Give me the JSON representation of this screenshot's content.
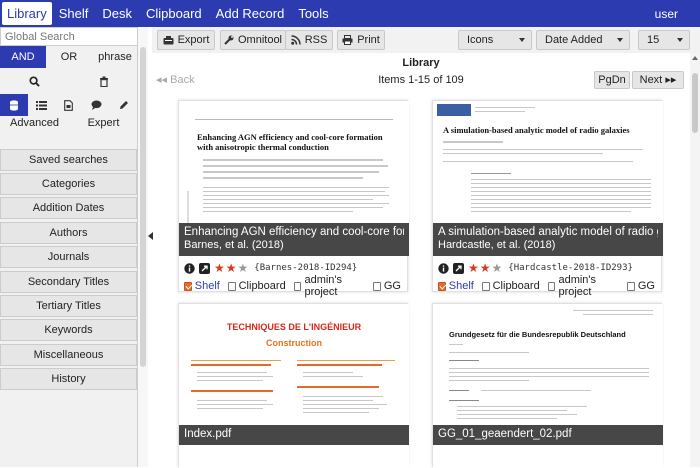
{
  "nav": {
    "items": [
      "Library",
      "Shelf",
      "Desk",
      "Clipboard",
      "Add Record",
      "Tools"
    ],
    "user": "user"
  },
  "sidebar": {
    "search_placeholder": "Global Search",
    "logic": [
      "AND",
      "OR",
      "phrase"
    ],
    "modes": [
      "Advanced",
      "Expert"
    ],
    "buttons": [
      "Saved searches",
      "Categories",
      "Addition Dates",
      "Authors",
      "Journals",
      "Secondary Titles",
      "Tertiary Titles",
      "Keywords",
      "Miscellaneous",
      "History"
    ]
  },
  "toolbar": {
    "export": "Export",
    "omnitool": "Omnitool",
    "rss": "RSS",
    "print": "Print",
    "view_select": "Icons",
    "sort_select": "Date Added",
    "per_page_select": "15"
  },
  "main": {
    "title": "Library",
    "back": "Back",
    "items_count": "Items 1-15 of 109",
    "pgdn": "PgDn",
    "next": "Next"
  },
  "cards": [
    {
      "title": "Enhancing AGN efficiency and cool-core formation",
      "authors": "Barnes, et al. (2018)",
      "key": "{Barnes-2018-ID294}",
      "stars": 3,
      "doc_title": "Enhancing AGN efficiency and cool-core formation with anisotropic thermal conduction",
      "tags": [
        {
          "label": "Shelf",
          "checked": true
        },
        {
          "label": "Clipboard",
          "checked": false
        },
        {
          "label": "admin's project",
          "checked": false
        },
        {
          "label": "GG",
          "checked": false
        }
      ]
    },
    {
      "title": "A simulation-based analytic model of radio galaxies",
      "authors": "Hardcastle, et al. (2018)",
      "key": "{Hardcastle-2018-ID293}",
      "stars": 3,
      "doc_title": "A simulation-based analytic model of radio galaxies",
      "tags": [
        {
          "label": "Shelf",
          "checked": true
        },
        {
          "label": "Clipboard",
          "checked": false
        },
        {
          "label": "admin's project",
          "checked": false
        },
        {
          "label": "GG",
          "checked": false
        }
      ]
    },
    {
      "title": "Index.pdf",
      "doc_title": "TECHNIQUES DE L'INGÉNIEUR",
      "doc_subtitle": "Construction"
    },
    {
      "title": "GG_01_geaendert_02.pdf",
      "doc_title": "Grundgesetz für die Bundesrepublik Deutschland"
    }
  ],
  "colors": {
    "nav": "#2c3bb0",
    "accent": "#ea6a2a",
    "star_on": "#d43c1a",
    "star_off": "#9a9a9a"
  }
}
